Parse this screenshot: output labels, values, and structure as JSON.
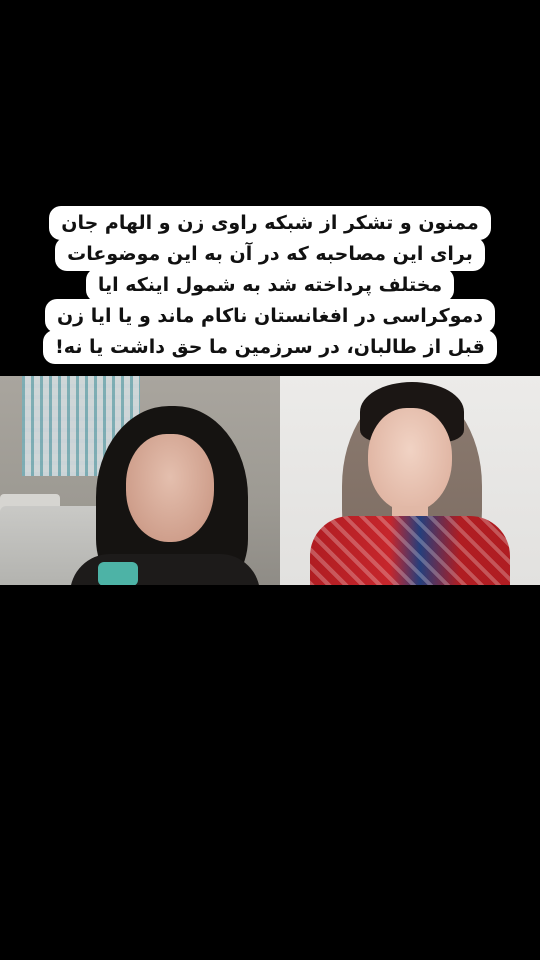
{
  "caption": {
    "lines": [
      "ممنون و تشکر از شبکه راوی زن و الهام جان",
      "برای این مصاحبه که در آن به این موضوعات",
      "مختلف پرداخته شد به شمول اینکه ایا",
      "دموکراسی در افغانستان ناکام ماند و یا ایا زن",
      "قبل از طالبان، در سرزمین ما حق داشت یا نه!"
    ]
  },
  "video": {
    "left_panel": "interviewer-video",
    "right_panel": "guest-video"
  }
}
